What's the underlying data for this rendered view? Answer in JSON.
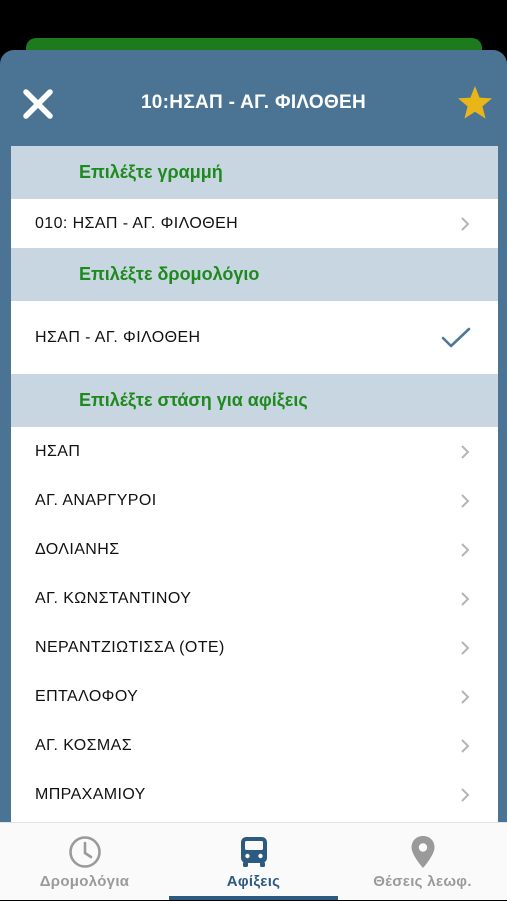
{
  "header": {
    "title": "10:ΗΣΑΠ - ΑΓ. ΦΙΛΟΘΕΗ",
    "close_icon": "close-icon",
    "favorite_icon": "star-icon",
    "favorite_color": "#e8b618"
  },
  "sections": {
    "line_header": "Επιλέξτε γραμμή",
    "line_value": "010: ΗΣΑΠ - ΑΓ. ΦΙΛΟΘΕΗ",
    "route_header": "Επιλέξτε δρομολόγιο",
    "route_value": "ΗΣΑΠ - ΑΓ. ΦΙΛΟΘΕΗ",
    "stop_header": "Επιλέξτε στάση για αφίξεις"
  },
  "stops": [
    "ΗΣΑΠ",
    "ΑΓ. ΑΝΑΡΓΥΡΟΙ",
    "ΔΟΛΙΑΝΗΣ",
    "ΑΓ. ΚΩΝΣΤΑΝΤΙΝΟΥ",
    "ΝΕΡΑΝΤΖΙΩΤΙΣΣΑ (ΟΤΕ)",
    "ΕΠΤΑΛΟΦΟΥ",
    "ΑΓ. ΚΟΣΜΑΣ",
    "ΜΠΡΑΧΑΜΙΟΥ"
  ],
  "tabs": [
    {
      "label": "Δρομολόγια",
      "icon": "clock-icon",
      "active": false
    },
    {
      "label": "Αφίξεις",
      "icon": "bus-icon",
      "active": true
    },
    {
      "label": "Θέσεις λεωφ.",
      "icon": "location-pin-icon",
      "active": false
    }
  ],
  "colors": {
    "header_bg": "#4a7394",
    "section_bg": "#c8d6e2",
    "section_text": "#1e8a1e",
    "active_tab": "#2c5a80",
    "inactive_tab": "#9a9a9a"
  }
}
